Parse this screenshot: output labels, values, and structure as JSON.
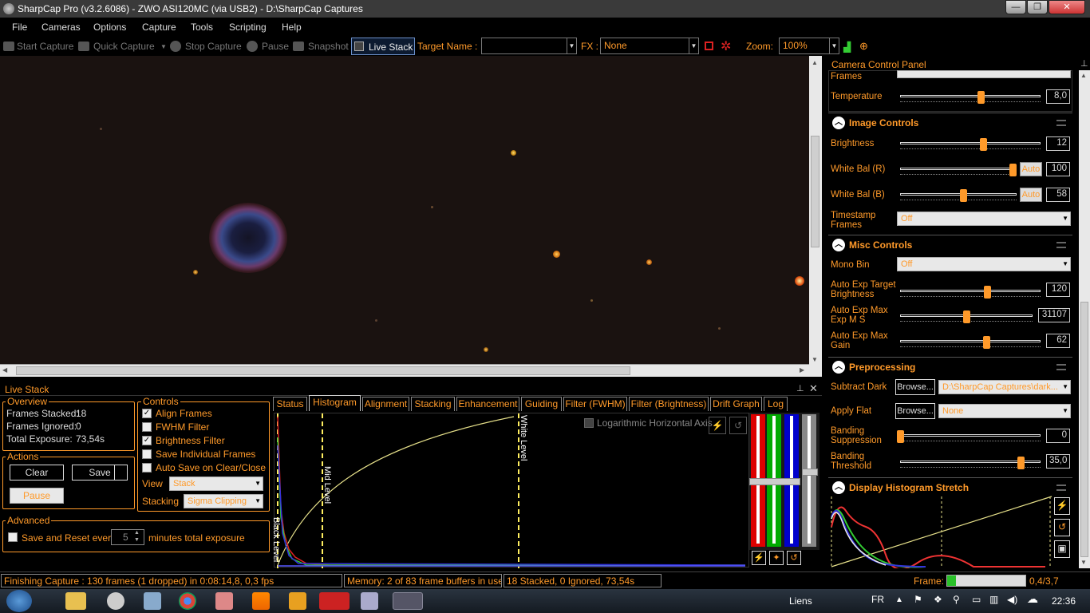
{
  "window": {
    "title": "SharpCap Pro (v3.2.6086) - ZWO ASI120MC (via USB2) - D:\\SharpCap Captures"
  },
  "menu": [
    "File",
    "Cameras",
    "Options",
    "Capture",
    "Tools",
    "Scripting",
    "Help"
  ],
  "toolbar": {
    "start_capture": "Start Capture",
    "quick_capture": "Quick Capture",
    "stop_capture": "Stop Capture",
    "pause": "Pause",
    "snapshot": "Snapshot",
    "live_stack": "Live Stack",
    "target_name_label": "Target Name :",
    "target_name_value": "",
    "fx_label": "FX :",
    "fx_value": "None",
    "zoom_label": "Zoom:",
    "zoom_value": "100%"
  },
  "camera_panel": {
    "title": "Camera Control Panel",
    "top_partial_label": "Frames",
    "temperature_label": "Temperature",
    "temperature_value": "8,0",
    "temperature_level": 0.58,
    "image_controls": {
      "title": "Image Controls",
      "brightness_label": "Brightness",
      "brightness_value": "12",
      "brightness_level": 0.6,
      "wb_r_label": "White Bal (R)",
      "wb_r_value": "100",
      "wb_r_level": 1.0,
      "wb_b_label": "White Bal (B)",
      "wb_b_value": "58",
      "wb_b_level": 0.55,
      "auto_label": "Auto",
      "timestamp_label": "Timestamp Frames",
      "timestamp_value": "Off"
    },
    "misc_controls": {
      "title": "Misc Controls",
      "mono_bin_label": "Mono Bin",
      "mono_bin_value": "Off",
      "auto_exp_target_label": "Auto Exp Target Brightness",
      "auto_exp_target_value": "120",
      "auto_exp_target_level": 0.63,
      "auto_exp_max_exp_label": "Auto Exp Max Exp M S",
      "auto_exp_max_exp_value": "31107",
      "auto_exp_max_exp_level": 0.5,
      "auto_exp_max_gain_label": "Auto Exp Max Gain",
      "auto_exp_max_gain_value": "62",
      "auto_exp_max_gain_level": 0.62
    },
    "preprocessing": {
      "title": "Preprocessing",
      "subtract_dark_label": "Subtract Dark",
      "browse_label": "Browse...",
      "subtract_dark_value": "D:\\SharpCap Captures\\dark...",
      "apply_flat_label": "Apply Flat",
      "apply_flat_value": "None",
      "banding_suppression_label": "Banding Suppression",
      "banding_suppression_value": "0",
      "banding_suppression_level": 0.0,
      "banding_threshold_label": "Banding Threshold",
      "banding_threshold_value": "35,0",
      "banding_threshold_level": 0.88
    },
    "display_histogram": {
      "title": "Display Histogram Stretch"
    }
  },
  "live_stack": {
    "title": "Live Stack",
    "overview": {
      "title": "Overview",
      "frames_stacked_label": "Frames Stacked:",
      "frames_stacked": "18",
      "frames_ignored_label": "Frames Ignored:",
      "frames_ignored": "0",
      "total_exposure_label": "Total Exposure:",
      "total_exposure": "73,54s"
    },
    "controls": {
      "title": "Controls",
      "align_frames": "Align Frames",
      "fwhm_filter": "FWHM Filter",
      "brightness_filter": "Brightness Filter",
      "save_individual": "Save Individual Frames",
      "auto_save": "Auto Save on Clear/Close",
      "view_label": "View",
      "view_value": "Stack",
      "stacking_label": "Stacking",
      "stacking_value": "Sigma Clipping"
    },
    "actions": {
      "title": "Actions",
      "clear": "Clear",
      "save": "Save",
      "pause": "Pause"
    },
    "advanced": {
      "title": "Advanced",
      "save_reset_label": "Save and Reset every",
      "save_reset_value": "5",
      "save_reset_suffix": "minutes total exposure"
    },
    "tabs": [
      "Status",
      "Histogram",
      "Alignment",
      "Stacking",
      "Enhancement",
      "Guiding",
      "Filter (FWHM)",
      "Filter (Brightness)",
      "Drift Graph",
      "Log"
    ],
    "histogram": {
      "log_axis_label": "Logarithmic Horizontal Axis",
      "black_level": "Black Level",
      "mid_level": "Mid Level",
      "white_level": "White Level"
    }
  },
  "status": {
    "capture": "Finishing Capture : 130 frames (1 dropped) in 0:08:14,8, 0,3 fps",
    "memory": "Memory: 2 of 83 frame buffers in use",
    "stack": "18 Stacked, 0 Ignored, 73,54s",
    "frame_label": "Frame:",
    "frame_value": "0,4/3,7",
    "frame_progress": 0.11
  },
  "taskbar": {
    "liens": "Liens",
    "lang": "FR",
    "time": "22:36"
  }
}
